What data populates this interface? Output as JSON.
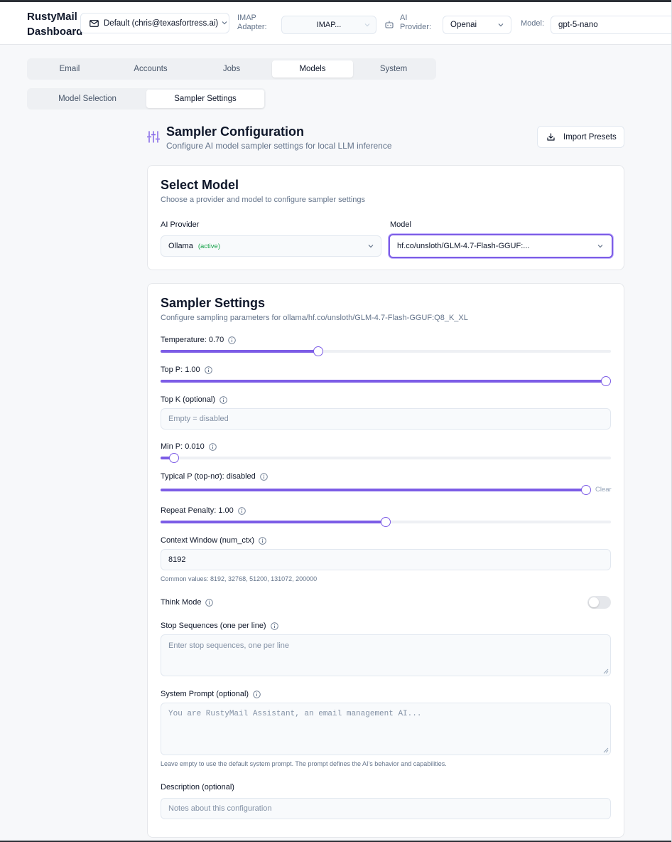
{
  "header": {
    "brand_line1": "RustyMail",
    "brand_line2": "Dashboard",
    "account": "Default (chris@texasfortress.ai)",
    "imap_label_1": "IMAP",
    "imap_label_2": "Adapter:",
    "imap_value": "IMAP...",
    "ai_label_1": "AI",
    "ai_label_2": "Provider:",
    "provider_value": "Openai",
    "model_label": "Model:",
    "model_value": "gpt-5-nano"
  },
  "tabs": [
    "Email",
    "Accounts",
    "Jobs",
    "Models",
    "System"
  ],
  "active_tab": "Models",
  "subtabs": [
    "Model Selection",
    "Sampler Settings"
  ],
  "active_subtab": "Sampler Settings",
  "page": {
    "title": "Sampler Configuration",
    "subtitle": "Configure AI model sampler settings for local LLM inference",
    "import_label": "Import Presets"
  },
  "select_model": {
    "title": "Select Model",
    "subtitle": "Choose a provider and model to configure sampler settings",
    "provider_label": "AI Provider",
    "provider_value": "Ollama",
    "provider_tag": "(active)",
    "model_label": "Model",
    "model_value": "hf.co/unsloth/GLM-4.7-Flash-GGUF:..."
  },
  "sampler": {
    "title": "Sampler Settings",
    "subtitle": "Configure sampling parameters for ollama/hf.co/unsloth/GLM-4.7-Flash-GGUF:Q8_K_XL",
    "temperature_label": "Temperature: 0.70",
    "temperature_fraction": 0.35,
    "top_p_label": "Top P: 1.00",
    "top_p_fraction": 1.0,
    "top_k_label": "Top K (optional)",
    "top_k_placeholder": "Empty = disabled",
    "min_p_label": "Min P: 0.010",
    "min_p_fraction": 0.03,
    "typical_p_label": "Typical P (top-nσ): disabled",
    "typical_p_fraction": 1.0,
    "clear_label": "Clear",
    "repeat_label": "Repeat Penalty: 1.00",
    "repeat_fraction": 0.5,
    "context_label": "Context Window (num_ctx)",
    "context_value": "8192",
    "context_hint": "Common values: 8192, 32768, 51200, 131072, 200000",
    "think_label": "Think Mode",
    "think_enabled": false,
    "stop_label": "Stop Sequences (one per line)",
    "stop_placeholder": "Enter stop sequences, one per line",
    "system_label": "System Prompt (optional)",
    "system_placeholder": "You are RustyMail Assistant, an email management AI...",
    "system_hint": "Leave empty to use the default system prompt. The prompt defines the AI's behavior and capabilities.",
    "description_label": "Description (optional)",
    "description_placeholder": "Notes about this configuration"
  },
  "colors": {
    "accent": "#7c5ce6",
    "active_green": "#16a34a"
  }
}
